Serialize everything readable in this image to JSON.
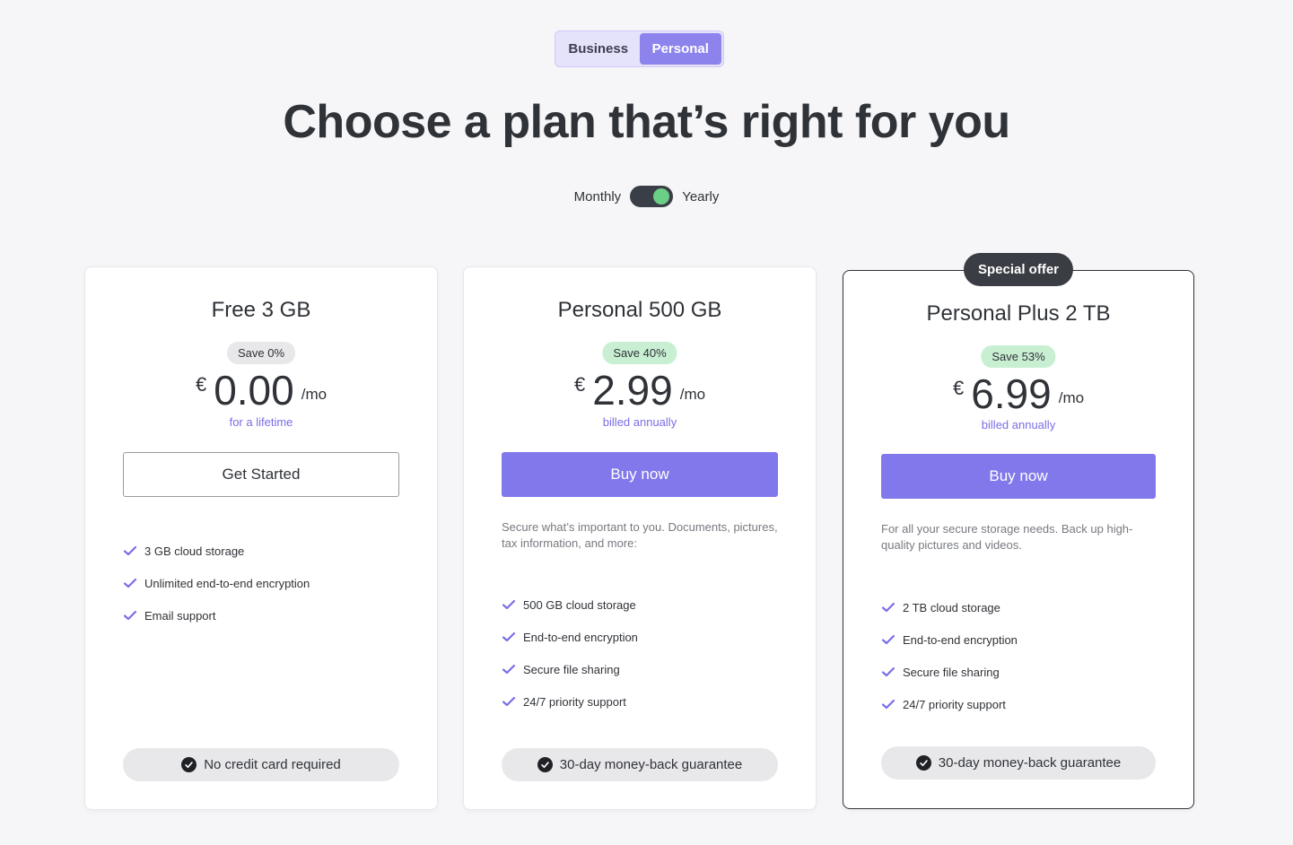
{
  "account_type": {
    "options": [
      "Business",
      "Personal"
    ],
    "selected": "Personal"
  },
  "headline": "Choose a plan that’s right for you",
  "billing": {
    "monthly_label": "Monthly",
    "yearly_label": "Yearly",
    "selected": "Yearly"
  },
  "colors": {
    "accent": "#8179eb",
    "toggle_on": "#6bcf85",
    "save_green": "#c9efd3",
    "dark": "#2f3237"
  },
  "plans": [
    {
      "name": "Free 3 GB",
      "save": "Save 0%",
      "currency": "€",
      "price": "0.00",
      "period": "/mo",
      "price_note": "for a lifetime",
      "cta": "Get Started",
      "description": "",
      "features": [
        "3 GB cloud storage",
        "Unlimited end-to-end encryption",
        "Email support"
      ],
      "footer": "No credit card required"
    },
    {
      "name": "Personal 500 GB",
      "save": "Save 40%",
      "currency": "€",
      "price": "2.99",
      "period": "/mo",
      "price_note": "billed annually",
      "cta": "Buy now",
      "description": "Secure what’s important to you. Documents, pictures, tax information, and more:",
      "features": [
        "500 GB cloud storage",
        "End-to-end encryption",
        "Secure file sharing",
        "24/7 priority support"
      ],
      "footer": "30-day money-back guarantee"
    },
    {
      "badge": "Special offer",
      "name": "Personal Plus 2 TB",
      "save": "Save 53%",
      "currency": "€",
      "price": "6.99",
      "period": "/mo",
      "price_note": "billed annually",
      "cta": "Buy now",
      "description": "For all your secure storage needs. Back up high-quality pictures and videos.",
      "features": [
        "2 TB cloud storage",
        "End-to-end encryption",
        "Secure file sharing",
        "24/7 priority support"
      ],
      "footer": "30-day money-back guarantee"
    }
  ]
}
